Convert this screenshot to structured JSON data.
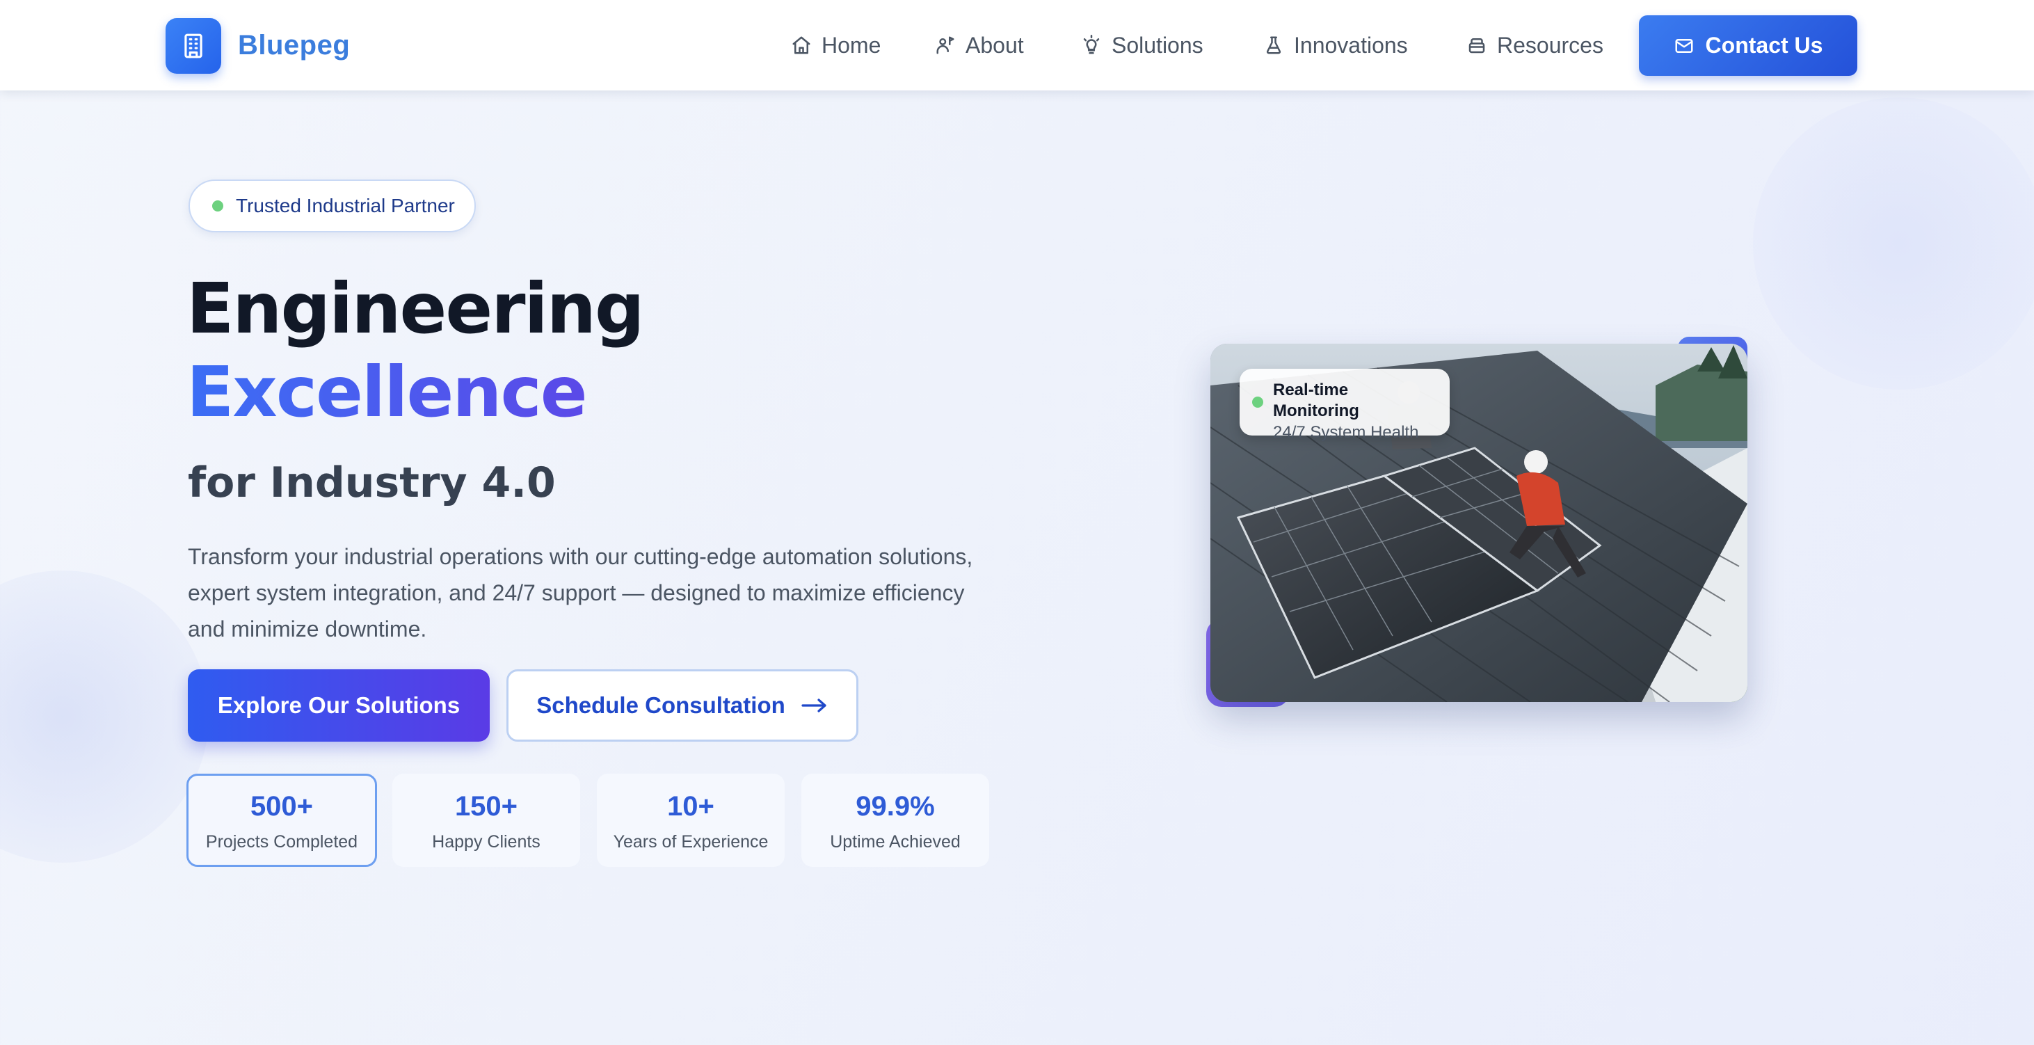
{
  "brand": {
    "name": "Bluepeg",
    "logo_icon": "building-icon"
  },
  "nav": {
    "items": [
      {
        "label": "Home",
        "icon": "home-icon"
      },
      {
        "label": "About",
        "icon": "person-flag-icon"
      },
      {
        "label": "Solutions",
        "icon": "lightbulb-icon"
      },
      {
        "label": "Innovations",
        "icon": "flask-icon"
      },
      {
        "label": "Resources",
        "icon": "stack-icon"
      }
    ],
    "contact_label": "Contact Us",
    "contact_icon": "mail-icon"
  },
  "hero": {
    "badge": "Trusted Industrial Partner",
    "title_line1": "Engineering",
    "title_line2": "Excellence",
    "title_line3": "for Industry 4.0",
    "description": "Transform your industrial operations with our cutting-edge automation solutions, expert system integration, and 24/7 support — designed to maximize efficiency and minimize downtime.",
    "primary_cta": "Explore Our Solutions",
    "secondary_cta": "Schedule Consultation",
    "secondary_cta_icon": "arrow-right-icon"
  },
  "stats": [
    {
      "value": "500+",
      "label": "Projects Completed"
    },
    {
      "value": "150+",
      "label": "Happy Clients"
    },
    {
      "value": "10+",
      "label": "Years of Experience"
    },
    {
      "value": "99.9%",
      "label": "Uptime Achieved"
    }
  ],
  "monitor_card": {
    "title": "Real-time Monitoring",
    "subtitle": "24/7 System Health"
  },
  "colors": {
    "brand_blue": "#2563eb",
    "accent_purple": "#5a3be6",
    "status_green": "#6dd17f"
  }
}
